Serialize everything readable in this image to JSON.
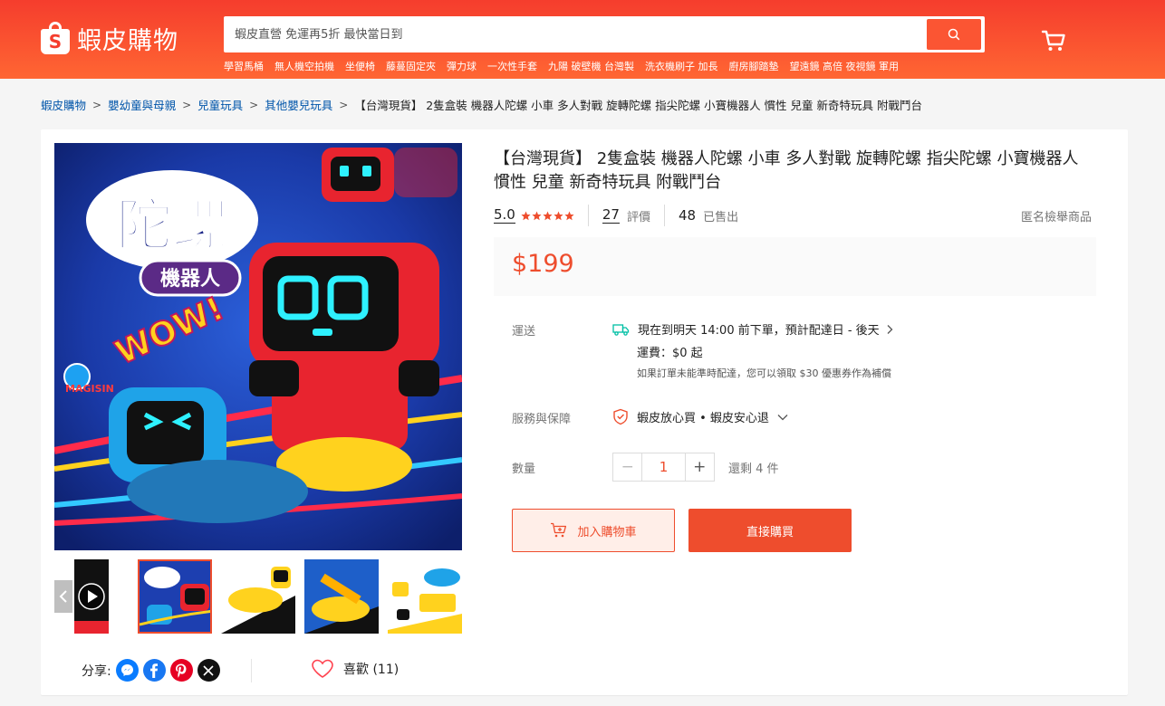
{
  "header": {
    "logo_text": "蝦皮購物",
    "logo_letter": "S",
    "search_placeholder": "蝦皮直營 免運再5折 最快當日到",
    "hot_links": [
      "學習馬桶",
      "無人機空拍機",
      "坐便椅",
      "藤蔓固定夾",
      "彈力球",
      "一次性手套",
      "九陽 破壁機 台灣製",
      "洗衣機刷子 加長",
      "廚房腳踏墊",
      "望遠鏡 高倍 夜視鏡 軍用"
    ],
    "accent_color": "#f53d2d"
  },
  "breadcrumb": {
    "items": [
      "蝦皮購物",
      "嬰幼童與母親",
      "兒童玩具",
      "其他嬰兒玩具"
    ],
    "current": "【台灣現貨】 2隻盒裝 機器人陀螺 小車 多人對戰 旋轉陀螺 指尖陀螺 小寶機器人 慣性 兒童 新奇特玩具 附戰鬥台",
    "separator": ">"
  },
  "product": {
    "title": "【台灣現貨】 2隻盒裝 機器人陀螺 小車 多人對戰 旋轉陀螺 指尖陀螺 小寶機器人 慣性 兒童 新奇特玩具 附戰鬥台",
    "rating": "5.0",
    "stars": 5,
    "reviews_count": "27",
    "reviews_label": "評價",
    "sold_count": "48",
    "sold_label": "已售出",
    "report_label": "匿名檢舉商品",
    "price": "$199",
    "price_color": "#ee4d2d"
  },
  "image": {
    "title_line1": "陀螺",
    "title_line2": "機器人",
    "wow": "WOW!",
    "brand": "MAGISIN",
    "thumbnails_count": 5,
    "active_thumbnail": 2
  },
  "shipping": {
    "label": "運送",
    "line1": "現在到明天 14:00 前下單，預計配達日 - 後天",
    "line2": "運費：$0 起",
    "line3": "如果訂單未能準時配達，您可以領取 $30 優惠券作為補償"
  },
  "guarantee": {
    "label": "服務與保障",
    "text": "蝦皮放心買 • 蝦皮安心退"
  },
  "quantity": {
    "label": "數量",
    "value": "1",
    "stock": "還剩 4 件",
    "minus": "−",
    "plus": "+"
  },
  "actions": {
    "add_to_cart": "加入購物車",
    "buy_now": "直接購買"
  },
  "social": {
    "share_label": "分享:",
    "networks": [
      "messenger",
      "facebook",
      "pinterest",
      "x"
    ],
    "like_label": "喜歡 (11)"
  }
}
